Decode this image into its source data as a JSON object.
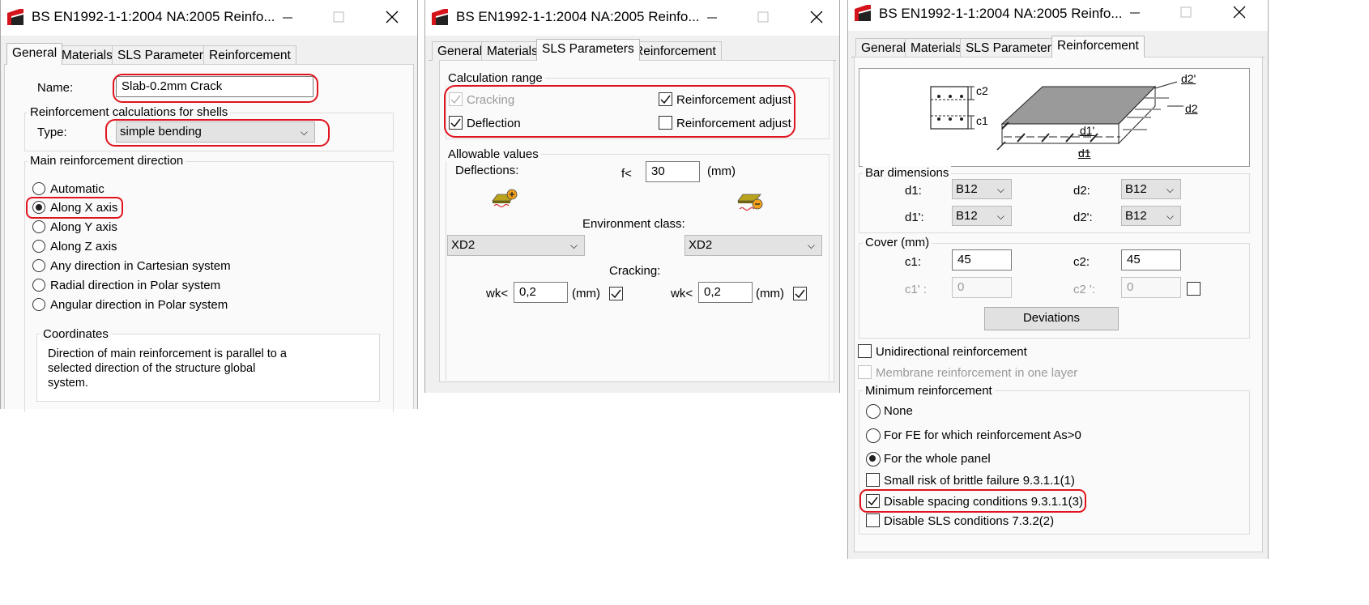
{
  "window_title": "BS EN1992-1-1:2004 NA:2005 Reinfo...",
  "tabs": [
    "General",
    "Materials",
    "SLS Parameters",
    "Reinforcement"
  ],
  "general": {
    "name_label": "Name:",
    "name_value": "Slab-0.2mm Crack",
    "shells_group": "Reinforcement calculations for shells",
    "type_label": "Type:",
    "type_value": "simple bending",
    "direction_group": "Main reinforcement direction",
    "directions": [
      "Automatic",
      "Along X axis",
      "Along Y axis",
      "Along Z axis",
      "Any direction in Cartesian system",
      "Radial direction in Polar system",
      "Angular direction in Polar system"
    ],
    "coordinates_group": "Coordinates",
    "coordinates_text": [
      "Direction of main reinforcement is parallel to a",
      "selected direction of the structure global",
      "system."
    ]
  },
  "sls": {
    "range_group": "Calculation range",
    "cracking": "Cracking",
    "deflection": "Deflection",
    "reinf_adjust_1": "Reinforcement adjust",
    "reinf_adjust_2": "Reinforcement adjust",
    "allowable_group": "Allowable values",
    "deflections_label": "Deflections:",
    "f_label": "f<",
    "f_value": "30",
    "f_unit": "(mm)",
    "env_label": "Environment class:",
    "env_left": "XD2",
    "env_right": "XD2",
    "cracking_label": "Cracking:",
    "wk_label": "wk<",
    "wk_left": "0,2",
    "wk_right": "0,2",
    "wk_unit": "(mm)"
  },
  "reinforcement": {
    "diagram_labels": {
      "c2": "c2",
      "c1": "c1",
      "d2p": "d2'",
      "d2": "d2",
      "d1p": "d1'",
      "d1": "d1"
    },
    "bar_group": "Bar dimensions",
    "d1_label": "d1:",
    "d1_value": "B12",
    "d2_label": "d2:",
    "d2_value": "B12",
    "d1p_label": "d1':",
    "d1p_value": "B12",
    "d2p_label": "d2':",
    "d2p_value": "B12",
    "cover_group": "Cover (mm)",
    "c1_label": "c1:",
    "c1_value": "45",
    "c2_label": "c2:",
    "c2_value": "45",
    "c1p_label": "c1' :",
    "c1p_value": "0",
    "c2p_label": "c2 ':",
    "c2p_value": "0",
    "deviations": "Deviations",
    "unidirectional": "Unidirectional reinforcement",
    "membrane": "Membrane reinforcement in one layer",
    "min_group": "Minimum reinforcement",
    "min_none": "None",
    "min_fe": "For FE for which reinforcement As>0",
    "min_whole": "For the whole panel",
    "brittle": "Small risk of brittle failure  9.3.1.1(1)",
    "spacing": "Disable spacing conditions 9.3.1.1(3)",
    "sls_cond": "Disable SLS conditions 7.3.2(2)"
  },
  "colors": {
    "highlight": "#e0141e",
    "icon_red": "#d4131b",
    "slab_top": "#9a9a9a"
  }
}
